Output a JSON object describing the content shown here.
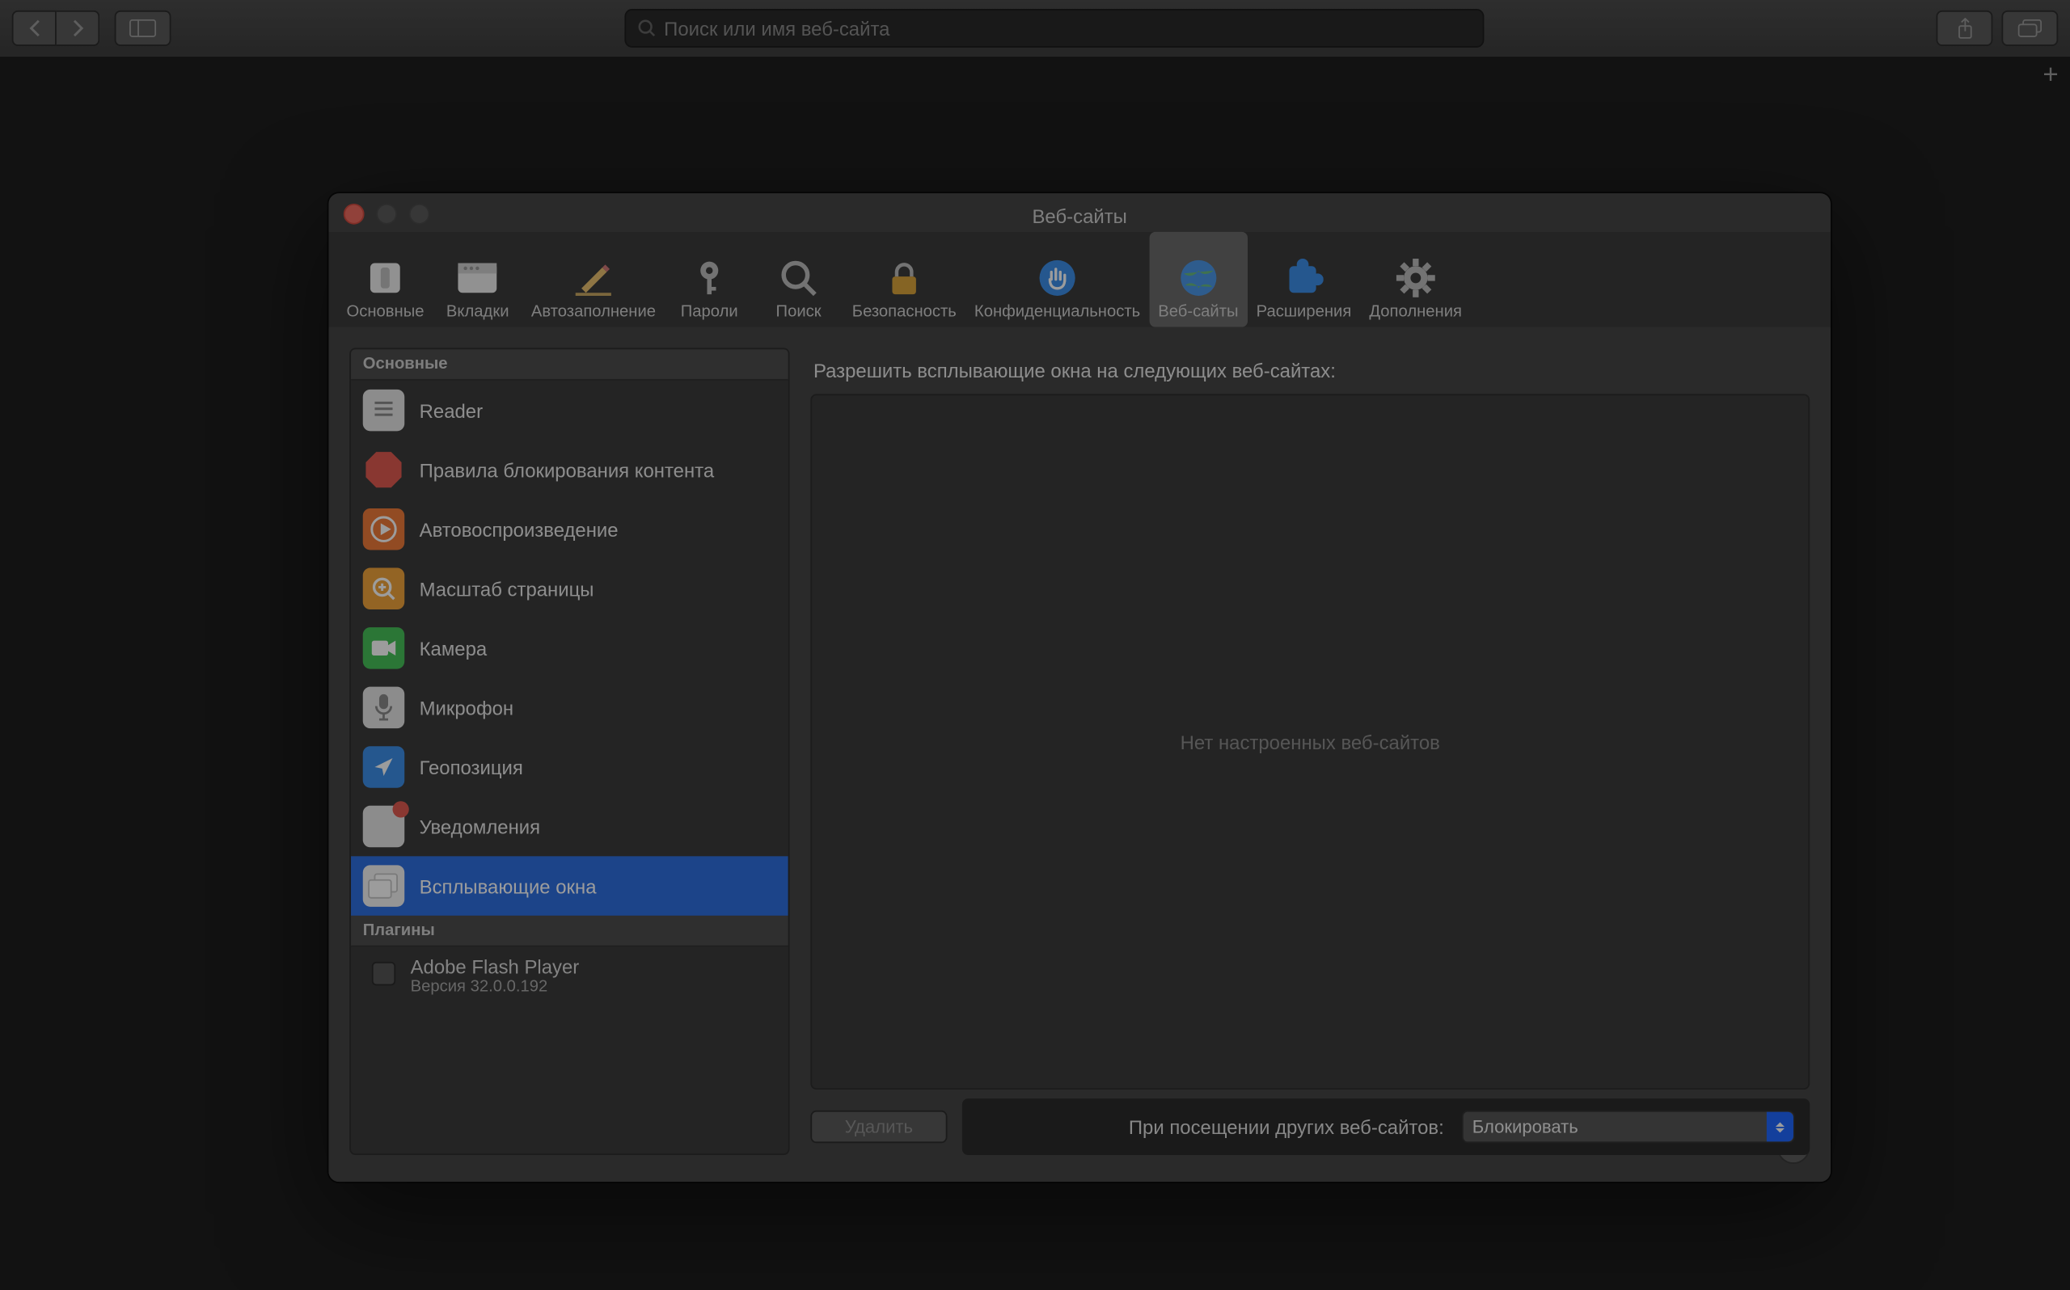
{
  "safari": {
    "search_placeholder": "Поиск или имя веб-сайта"
  },
  "prefs": {
    "title": "Веб-сайты",
    "tabs": [
      {
        "id": "general",
        "label": "Основные"
      },
      {
        "id": "tabs",
        "label": "Вкладки"
      },
      {
        "id": "autofill",
        "label": "Автозаполнение"
      },
      {
        "id": "passwords",
        "label": "Пароли"
      },
      {
        "id": "search",
        "label": "Поиск"
      },
      {
        "id": "security",
        "label": "Безопасность"
      },
      {
        "id": "privacy",
        "label": "Конфиденциальность"
      },
      {
        "id": "websites",
        "label": "Веб-сайты"
      },
      {
        "id": "extensions",
        "label": "Расширения"
      },
      {
        "id": "advanced",
        "label": "Дополнения"
      }
    ],
    "sidebar": {
      "section1_header": "Основные",
      "items": [
        {
          "id": "reader",
          "label": "Reader"
        },
        {
          "id": "content-blockers",
          "label": "Правила блокирования контента"
        },
        {
          "id": "autoplay",
          "label": "Автовоспроизведение"
        },
        {
          "id": "page-zoom",
          "label": "Масштаб страницы"
        },
        {
          "id": "camera",
          "label": "Камера"
        },
        {
          "id": "microphone",
          "label": "Микрофон"
        },
        {
          "id": "location",
          "label": "Геопозиция"
        },
        {
          "id": "notifications",
          "label": "Уведомления"
        },
        {
          "id": "popups",
          "label": "Всплывающие окна"
        }
      ],
      "section2_header": "Плагины",
      "plugins": [
        {
          "name": "Adobe Flash Player",
          "version": "Версия 32.0.0.192"
        }
      ]
    },
    "content": {
      "heading": "Разрешить всплывающие окна на следующих веб-сайтах:",
      "empty_text": "Нет настроенных веб-сайтов",
      "remove_label": "Удалить",
      "rule_label": "При посещении других веб-сайтов:",
      "rule_value": "Блокировать"
    }
  }
}
